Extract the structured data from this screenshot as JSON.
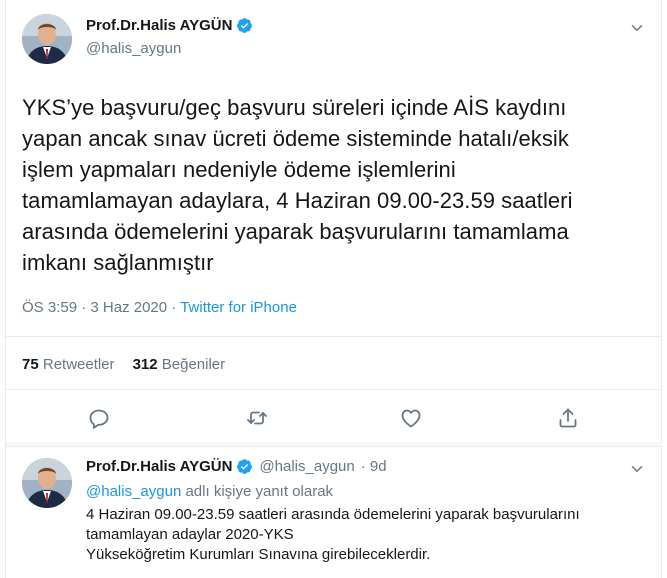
{
  "tweet": {
    "author": {
      "display_name": "Prof.Dr.Halis AYGÜN",
      "handle": "@halis_aygun",
      "avatar": "profile-photo",
      "verified_icon": "verified-badge-icon"
    },
    "text_lines": [
      "YKS’ye başvuru/geç başvuru süreleri içinde AİS kaydını",
      "yapan ancak sınav ücreti ödeme sisteminde hatalı/eksik",
      "işlem yapmaları nedeniyle ödeme işlemlerini",
      "tamamlamayan adaylara, 4 Haziran 09.00-23.59 saatleri",
      "arasında ödemelerini yaparak başvurularını tamamlama",
      "imkanı sağlanmıştır"
    ],
    "time": "ÖS 3:59",
    "separator": " · ",
    "date": "3 Haz 2020",
    "source": "Twitter for iPhone",
    "retweets_count": "75",
    "retweets_label": "Retweetler",
    "likes_count": "312",
    "likes_label": "Beğeniler",
    "actions": [
      {
        "icon": "reply-icon",
        "label": "Reply"
      },
      {
        "icon": "retweet-icon",
        "label": "Retweet"
      },
      {
        "icon": "like-icon",
        "label": "Like"
      },
      {
        "icon": "share-icon",
        "label": "Share"
      }
    ],
    "menu_icon": "chevron-down-icon"
  },
  "reply": {
    "author": {
      "display_name": "Prof.Dr.Halis AYGÜN",
      "handle": "@halis_aygun",
      "verified_icon": "verified-badge-icon"
    },
    "age": "· 9d",
    "reply_to_mention": "@halis_aygun",
    "reply_to_suffix": " adlı kişiye yanıt olarak",
    "text_lines": [
      "4 Haziran 09.00-23.59 saatleri arasında ödemelerini yaparak başvurularını",
      "tamamlayan adaylar 2020-YKS",
      "Yükseköğretim Kurumları Sınavına girebileceklerdir."
    ],
    "menu_icon": "chevron-down-icon"
  },
  "colors": {
    "accent": "#1b95e0",
    "secondary_text": "#657786",
    "primary_text": "#14171a",
    "divider": "#e6ecf0",
    "verified": "#1da1f2"
  }
}
